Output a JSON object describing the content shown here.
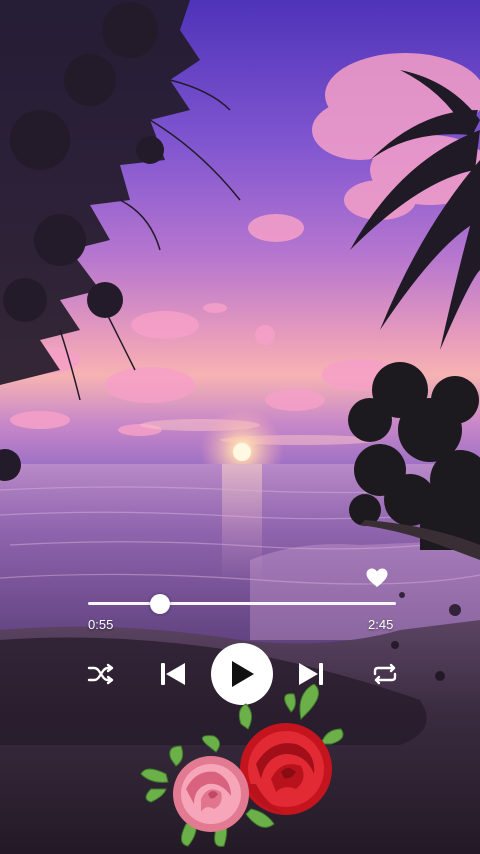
{
  "background": {
    "scene": "sunset-beach-with-palms"
  },
  "player": {
    "elapsed": "0:55",
    "duration": "2:45",
    "progress": 0.235,
    "liked": true
  },
  "icons": {
    "heart": "heart-icon",
    "shuffle": "shuffle-icon",
    "previous": "skip-previous-icon",
    "play": "play-icon",
    "next": "skip-next-icon",
    "repeat": "repeat-icon",
    "decoration": "roses-decoration"
  },
  "colors": {
    "sky_top": "#5a3fc0",
    "sky_mid": "#9a6ad8",
    "horizon": "#f2a0b8",
    "sun": "#fff3d0",
    "water": "#8a5fa8",
    "sand": "#2e2233",
    "controls": "#ffffff",
    "rose_red": "#d0202a",
    "rose_pink": "#f28aa0"
  }
}
